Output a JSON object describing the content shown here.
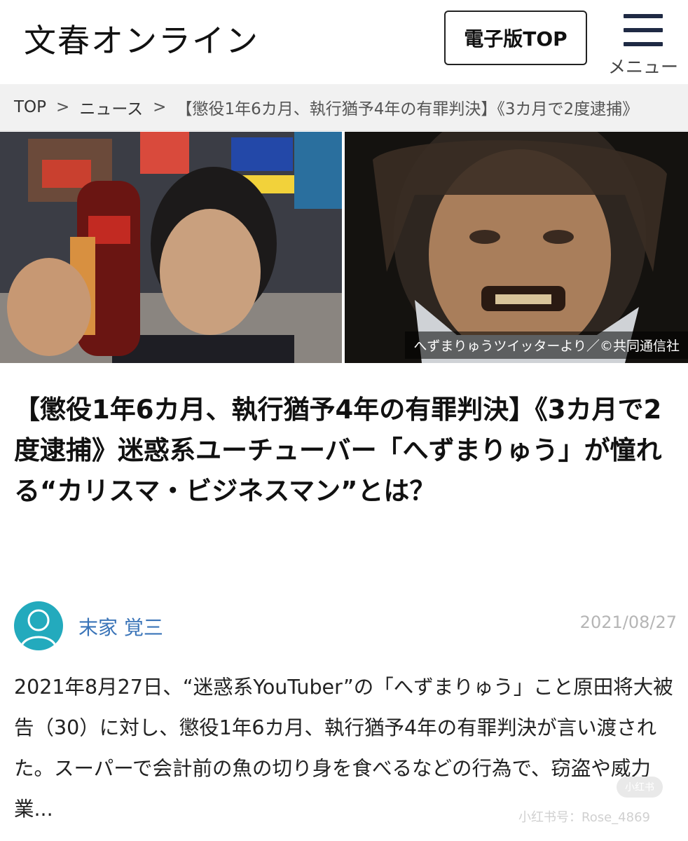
{
  "header": {
    "logo": "文春オンライン",
    "edition_button": "電子版TOP",
    "menu_label": "メニュー",
    "menu_icon": "hamburger-icon"
  },
  "breadcrumb": {
    "items": [
      "TOP",
      "ニュース",
      "【懲役1年6カ月、執行猶予4年の有罪判決】《3カ月で2度逮捕》"
    ],
    "separator": ">"
  },
  "hero": {
    "caption": "へずまりゅうツイッターより／©共同通信社"
  },
  "article": {
    "title": "【懲役1年6カ月、執行猶予4年の有罪判決】《3カ月で2度逮捕》迷惑系ユーチューバー「へずまりゅう」が憧れる“カリスマ・ビジネスマン”とは？",
    "author": "末家 覚三",
    "date": "2021/08/27",
    "lead": "2021年8月27日、“迷惑系YouTuber”の「へずまりゅう」こと原田将大被告（30）に対し、懲役1年6カ月、執行猶予4年の有罪判決が言い渡された。スーパーで会計前の魚の切り身を食べるなどの行為で、窃盗や威力業..."
  },
  "watermark": {
    "text": "小红书号：Rose_4869",
    "badge": "小红书"
  },
  "colors": {
    "author_link": "#3a74b8",
    "avatar_bg": "#23aabd",
    "breadcrumb_bg": "#f1f1f1"
  }
}
